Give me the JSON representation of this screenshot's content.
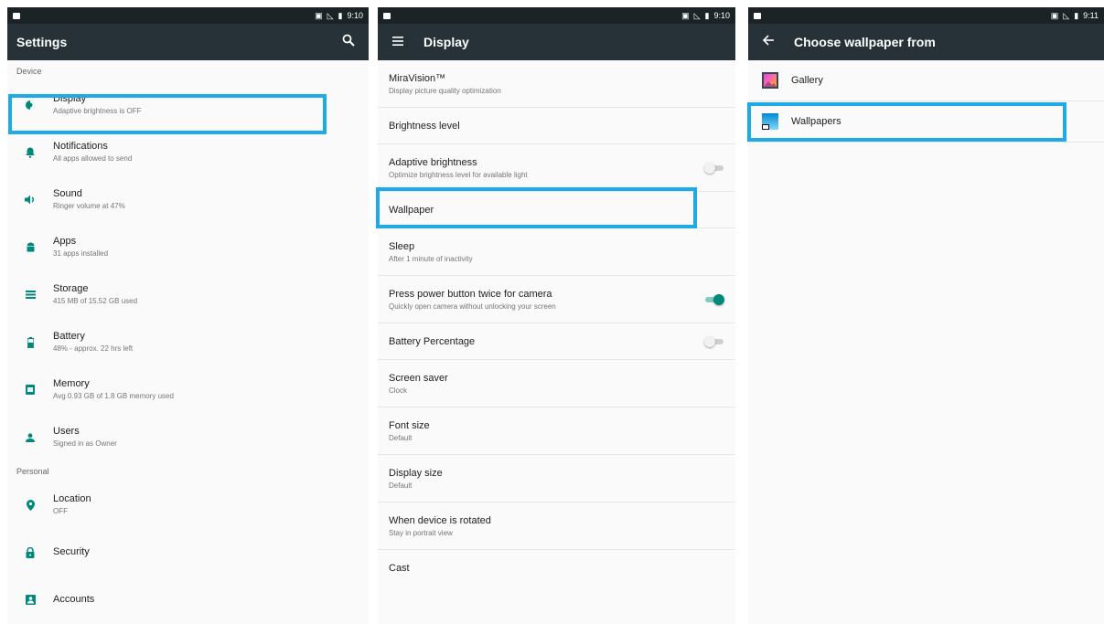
{
  "colors": {
    "toolbar": "#263238",
    "statusbar": "#1c2326",
    "accent": "#00897b",
    "highlight": "#1eaae7"
  },
  "settings": {
    "status_time": "9:10",
    "title": "Settings",
    "search_icon": "search-icon",
    "device_header": "Device",
    "device_items": [
      {
        "icon": "brightness-icon",
        "title": "Display",
        "subtitle": "Adaptive brightness is OFF"
      },
      {
        "icon": "bell-icon",
        "title": "Notifications",
        "subtitle": "All apps allowed to send"
      },
      {
        "icon": "volume-icon",
        "title": "Sound",
        "subtitle": "Ringer volume at 47%"
      },
      {
        "icon": "android-icon",
        "title": "Apps",
        "subtitle": "31 apps installed"
      },
      {
        "icon": "storage-icon",
        "title": "Storage",
        "subtitle": "415 MB of 15.52 GB used"
      },
      {
        "icon": "battery-icon",
        "title": "Battery",
        "subtitle": "48% - approx. 22 hrs left"
      },
      {
        "icon": "memory-icon",
        "title": "Memory",
        "subtitle": "Avg 0.93 GB of 1.8 GB memory used"
      },
      {
        "icon": "person-icon",
        "title": "Users",
        "subtitle": "Signed in as Owner"
      }
    ],
    "personal_header": "Personal",
    "personal_items": [
      {
        "icon": "location-icon",
        "title": "Location",
        "subtitle": "OFF"
      },
      {
        "icon": "lock-icon",
        "title": "Security",
        "subtitle": ""
      },
      {
        "icon": "account-box-icon",
        "title": "Accounts",
        "subtitle": ""
      }
    ]
  },
  "display": {
    "status_time": "9:10",
    "title": "Display",
    "items": [
      {
        "title": "MiraVision™",
        "subtitle": "Display picture quality optimization"
      },
      {
        "title": "Brightness level",
        "subtitle": ""
      },
      {
        "title": "Adaptive brightness",
        "subtitle": "Optimize brightness level for available light",
        "toggle": false
      },
      {
        "title": "Wallpaper",
        "subtitle": ""
      },
      {
        "title": "Sleep",
        "subtitle": "After 1 minute of inactivity"
      },
      {
        "title": "Press power button twice for camera",
        "subtitle": "Quickly open camera without unlocking your screen",
        "toggle": true
      },
      {
        "title": "Battery Percentage",
        "subtitle": "",
        "toggle": false
      },
      {
        "title": "Screen saver",
        "subtitle": "Clock"
      },
      {
        "title": "Font size",
        "subtitle": "Default"
      },
      {
        "title": "Display size",
        "subtitle": "Default"
      },
      {
        "title": "When device is rotated",
        "subtitle": "Stay in portrait view"
      },
      {
        "title": "Cast",
        "subtitle": ""
      }
    ]
  },
  "wallpaper": {
    "status_time": "9:11",
    "title": "Choose wallpaper from",
    "items": [
      {
        "icon": "gallery-icon",
        "title": "Gallery"
      },
      {
        "icon": "wallpapers-icon",
        "title": "Wallpapers"
      }
    ]
  }
}
